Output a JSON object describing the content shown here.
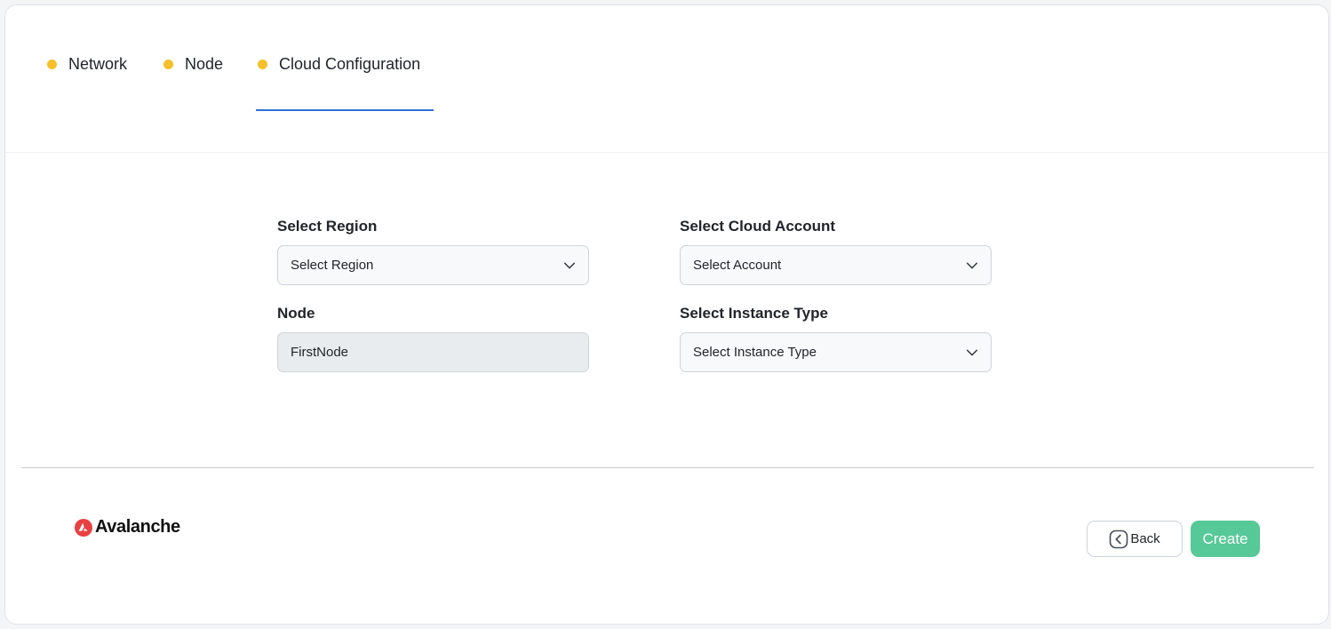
{
  "colors": {
    "tab_dot": "#f5c02a",
    "active_tab_underline": "#2f6fd6",
    "create_button": "#57c897",
    "logo_red": "#e84142"
  },
  "tabs": [
    {
      "label": "Network"
    },
    {
      "label": "Node"
    },
    {
      "label": "Cloud Configuration",
      "active": true
    }
  ],
  "form": {
    "region": {
      "label": "Select Region",
      "value": "Select Region",
      "icon": "chevron-down-icon"
    },
    "cloud_account": {
      "label": "Select Cloud Account",
      "value": "Select Account",
      "icon": "chevron-down-icon"
    },
    "node": {
      "label": "Node",
      "value": "FirstNode"
    },
    "instance_type": {
      "label": "Select Instance Type",
      "value": "Select Instance Type",
      "icon": "chevron-down-icon"
    }
  },
  "footer": {
    "logo_text": "Avalanche",
    "back_label": "Back",
    "back_icon": "chevron-left-circle-icon",
    "create_label": "Create"
  }
}
